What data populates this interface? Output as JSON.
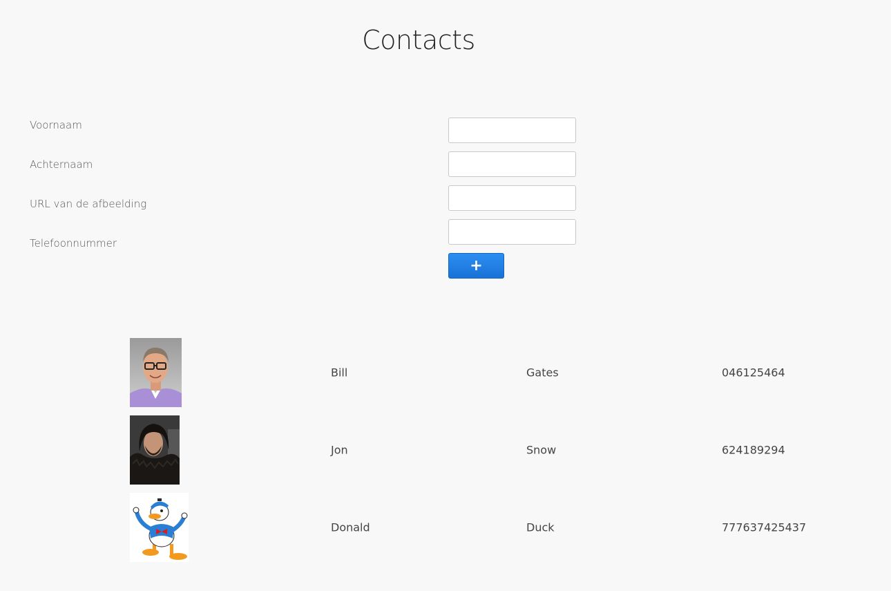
{
  "page": {
    "title": "Contacts"
  },
  "form": {
    "fields": [
      {
        "label": "Voornaam",
        "value": "",
        "placeholder": ""
      },
      {
        "label": "Achternaam",
        "value": "",
        "placeholder": ""
      },
      {
        "label": "URL van de afbeelding",
        "value": "",
        "placeholder": ""
      },
      {
        "label": "Telefoonnummer",
        "value": "",
        "placeholder": ""
      }
    ],
    "add_button_label": "+"
  },
  "contacts": [
    {
      "first_name": "Bill",
      "last_name": "Gates",
      "phone": "046125464",
      "avatar": "photo-bill-gates"
    },
    {
      "first_name": "Jon",
      "last_name": "Snow",
      "phone": "624189294",
      "avatar": "photo-jon-snow"
    },
    {
      "first_name": "Donald",
      "last_name": "Duck",
      "phone": "777637425437",
      "avatar": "illustration-donald-duck"
    }
  ],
  "colors": {
    "background": "#f8f8f8",
    "button": "#1872d8"
  }
}
